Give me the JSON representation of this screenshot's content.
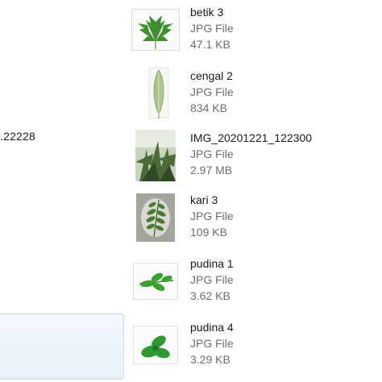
{
  "left_fragment_text": ".22228",
  "files": [
    {
      "name": "betik 3",
      "type": "JPG File",
      "size": "47.1 KB",
      "icon": "papaya-leaf-thumbnail"
    },
    {
      "name": "cengal 2",
      "type": "JPG File",
      "size": "834 KB",
      "icon": "single-leaf-thumbnail"
    },
    {
      "name": "IMG_20201221_122300",
      "type": "JPG File",
      "size": "2.97 MB",
      "icon": "plant-photo-thumbnail"
    },
    {
      "name": "kari 3",
      "type": "JPG File",
      "size": "109 KB",
      "icon": "curry-leaf-thumbnail"
    },
    {
      "name": "pudina 1",
      "type": "JPG File",
      "size": "3.62 KB",
      "icon": "mint-sprig-thumbnail"
    },
    {
      "name": "pudina 4",
      "type": "JPG File",
      "size": "3.29 KB",
      "icon": "mint-leaves-thumbnail"
    }
  ]
}
